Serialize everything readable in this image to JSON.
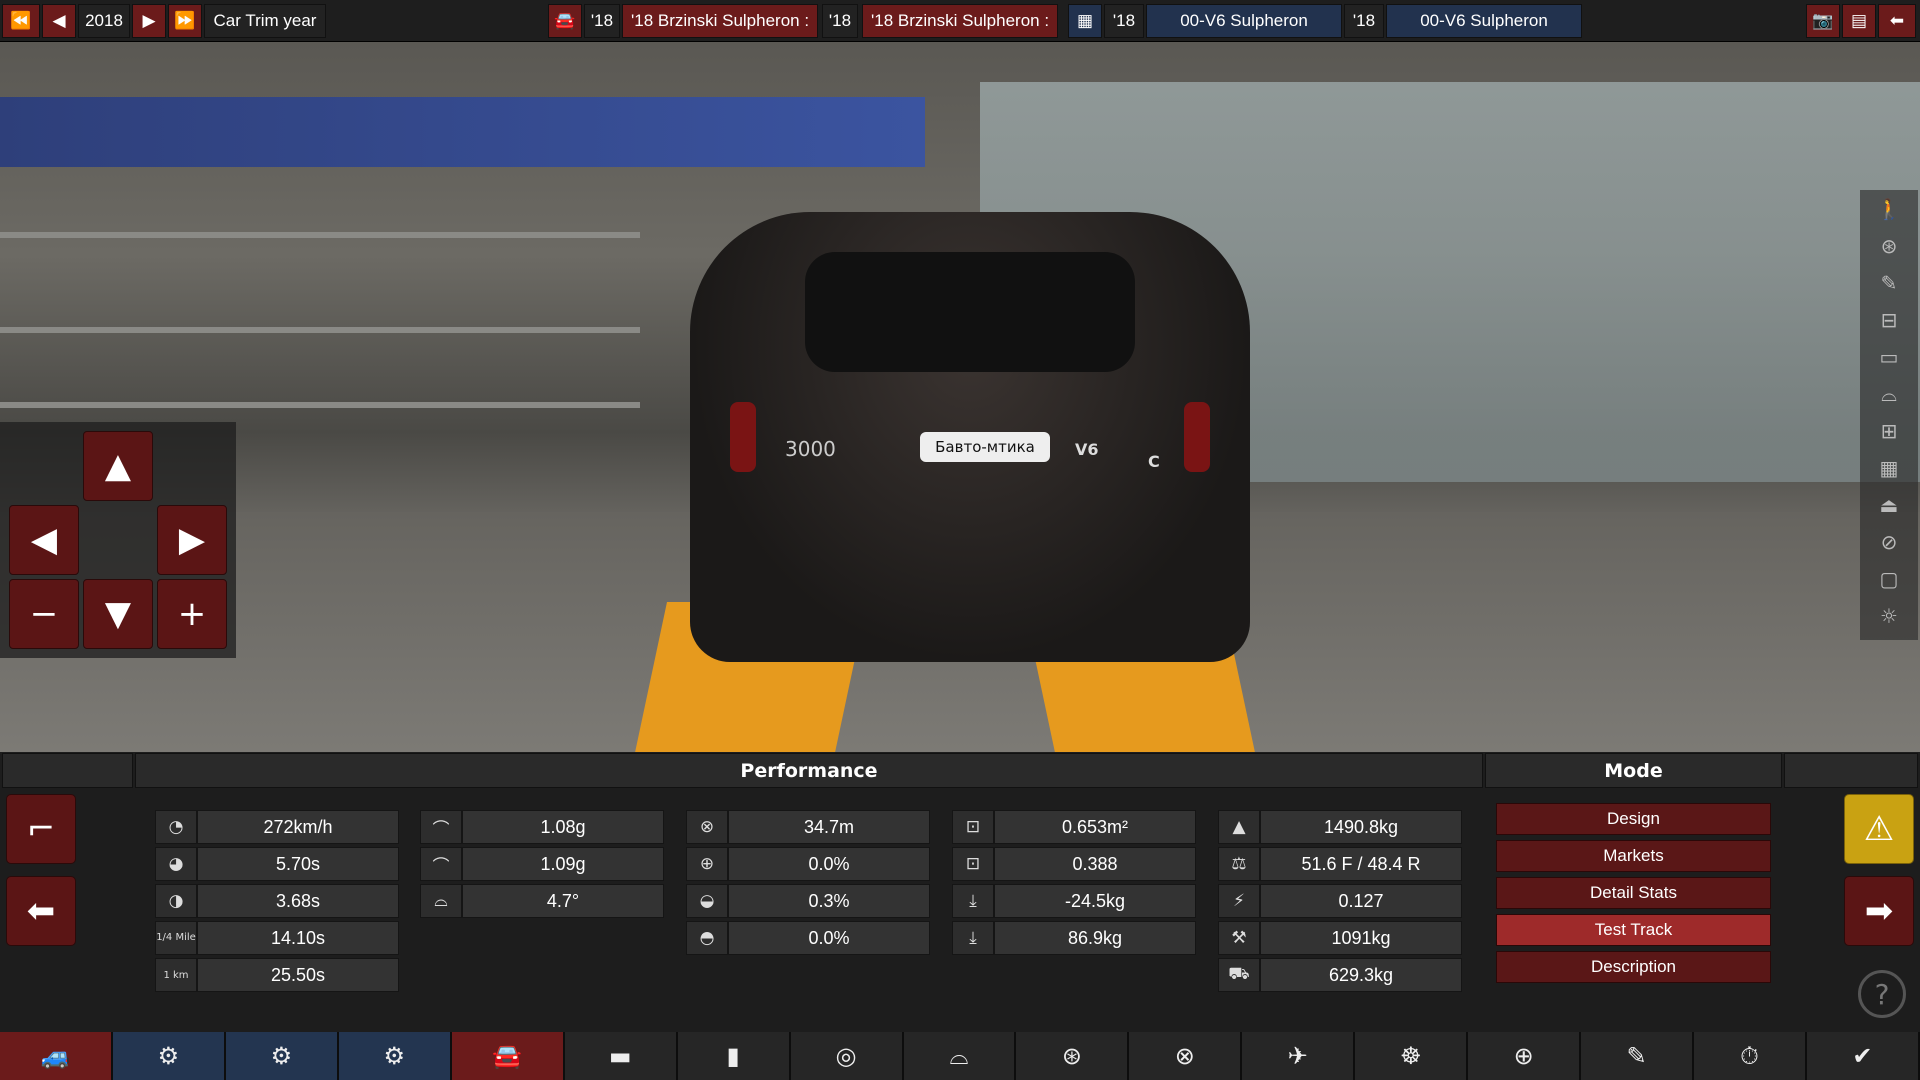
{
  "topbar": {
    "year": "2018",
    "year_label": "Car Trim year",
    "model_year_1": "'18",
    "model_name_1": "'18 Brzinski Sulpheron :",
    "model_year_2": "'18",
    "model_name_2": "'18 Brzinski Sulpheron :",
    "engine_year_1": "'18",
    "engine_name_1": "00-V6 Sulpheron",
    "engine_year_2": "'18",
    "engine_name_2": "00-V6 Sulpheron"
  },
  "scene": {
    "plate_text": "Бавто-мтика",
    "trunk_badge_left": "3000",
    "trunk_badge_right": "V6",
    "trunk_badge_c": "C"
  },
  "performance": {
    "title": "Performance",
    "col1": [
      "272km/h",
      "5.70s",
      "3.68s",
      "14.10s",
      "25.50s"
    ],
    "col1_labels": [
      "",
      "",
      "",
      "1/4 Mile",
      "1 km"
    ],
    "col2": [
      "1.08g",
      "1.09g",
      "4.7°"
    ],
    "col3": [
      "34.7m",
      "0.0%",
      "0.3%",
      "0.0%"
    ],
    "col4": [
      "0.653m²",
      "0.388",
      "-24.5kg",
      "86.9kg"
    ],
    "col5": [
      "1490.8kg",
      "51.6 F / 48.4 R",
      "0.127",
      "1091kg",
      "629.3kg"
    ]
  },
  "mode": {
    "title": "Mode",
    "items": [
      "Design",
      "Markets",
      "Detail Stats",
      "Test Track",
      "Description"
    ],
    "active": "Test Track"
  },
  "colors": {
    "accent_red": "#6b1b1b",
    "active_red": "#9e2a2a",
    "nav_blue": "#233550",
    "warning_yellow": "#c9a212",
    "lift_orange": "#e69a1e"
  }
}
